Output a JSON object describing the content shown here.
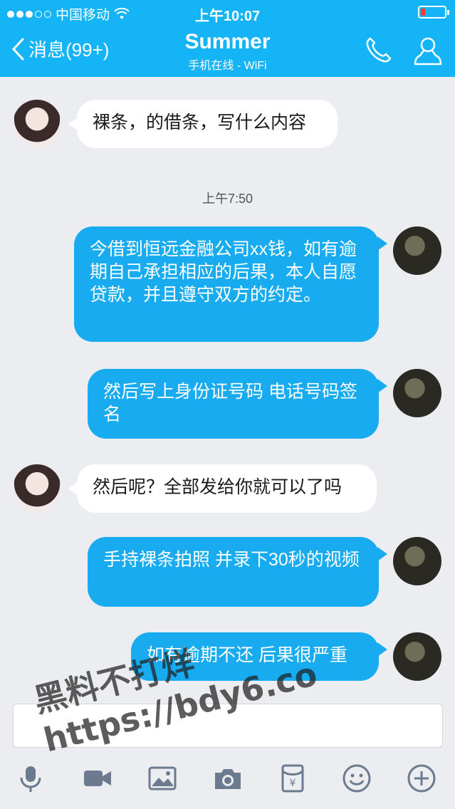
{
  "status_bar": {
    "carrier": "中国移动",
    "time": "上午10:07"
  },
  "header": {
    "back_label": "消息(99+)",
    "title": "Summer",
    "subtitle": "手机在线 - WiFi"
  },
  "messages": [
    {
      "side": "in",
      "text": "裸条，的借条，写什么内容"
    },
    {
      "side": "timestamp",
      "text": "上午7:50"
    },
    {
      "side": "out",
      "text": "今借到恒远金融公司xx钱，如有逾期自己承担相应的后果，本人自愿贷款，并且遵守双方的约定。"
    },
    {
      "side": "out",
      "text": "然后写上身份证号码 电话号码签名"
    },
    {
      "side": "in",
      "text": "然后呢？全部发给你就可以了吗"
    },
    {
      "side": "out",
      "text": "手持裸条拍照 并录下30秒的视频"
    },
    {
      "side": "out",
      "text": "如有逾期不还 后果很严重"
    }
  ],
  "toolbar": {
    "icons": [
      "microphone-icon",
      "video-icon",
      "image-icon",
      "camera-icon",
      "red-packet-icon",
      "emoji-icon",
      "plus-icon"
    ]
  },
  "watermark": {
    "line1": "黑料不打烊",
    "line2": "https://bdy6.co"
  },
  "colors": {
    "header": "#14b4f6",
    "outgoing_bubble": "#18abef",
    "incoming_bubble": "#ffffff",
    "background": "#ebedf0"
  }
}
